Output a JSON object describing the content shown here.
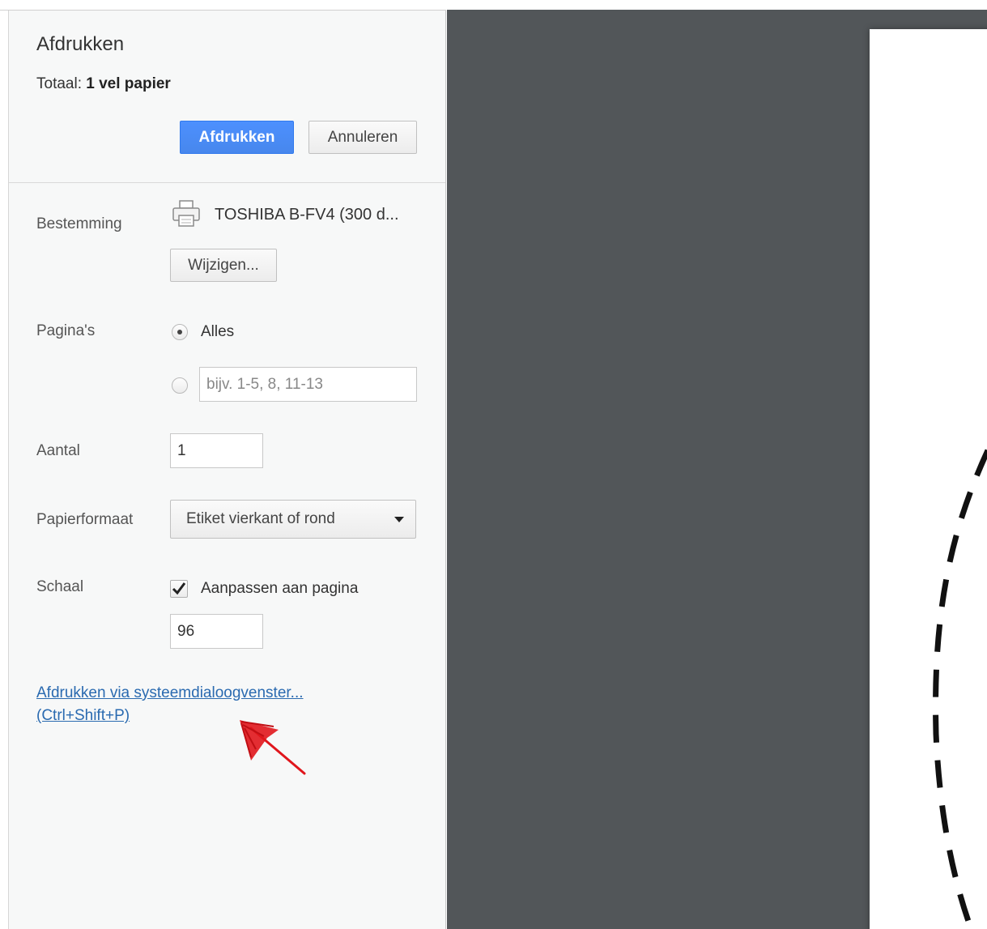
{
  "header": {
    "title": "Afdrukken",
    "summary_label": "Totaal:",
    "summary_value": "1 vel papier",
    "print_button": "Afdrukken",
    "cancel_button": "Annuleren"
  },
  "destination": {
    "label": "Bestemming",
    "printer_icon": "printer-icon",
    "printer_name": "TOSHIBA B-FV4 (300 d...",
    "change_button": "Wijzigen..."
  },
  "pages": {
    "label": "Pagina's",
    "option_all": "Alles",
    "option_all_selected": true,
    "range_placeholder": "bijv. 1-5, 8, 11-13",
    "range_value": ""
  },
  "copies": {
    "label": "Aantal",
    "value": "1"
  },
  "paper_size": {
    "label": "Papierformaat",
    "selected": "Etiket vierkant of rond"
  },
  "scale": {
    "label": "Schaal",
    "fit_to_page_label": "Aanpassen aan pagina",
    "fit_to_page_checked": true,
    "value": "96"
  },
  "system_dialog": {
    "link_text": "Afdrukken via systeemdialoogvenster...",
    "shortcut": "(Ctrl+Shift+P)"
  },
  "colors": {
    "accent": "#4d90fe",
    "link": "#2a6ab0",
    "preview_background": "#525659",
    "annotation": "#e0161c"
  }
}
